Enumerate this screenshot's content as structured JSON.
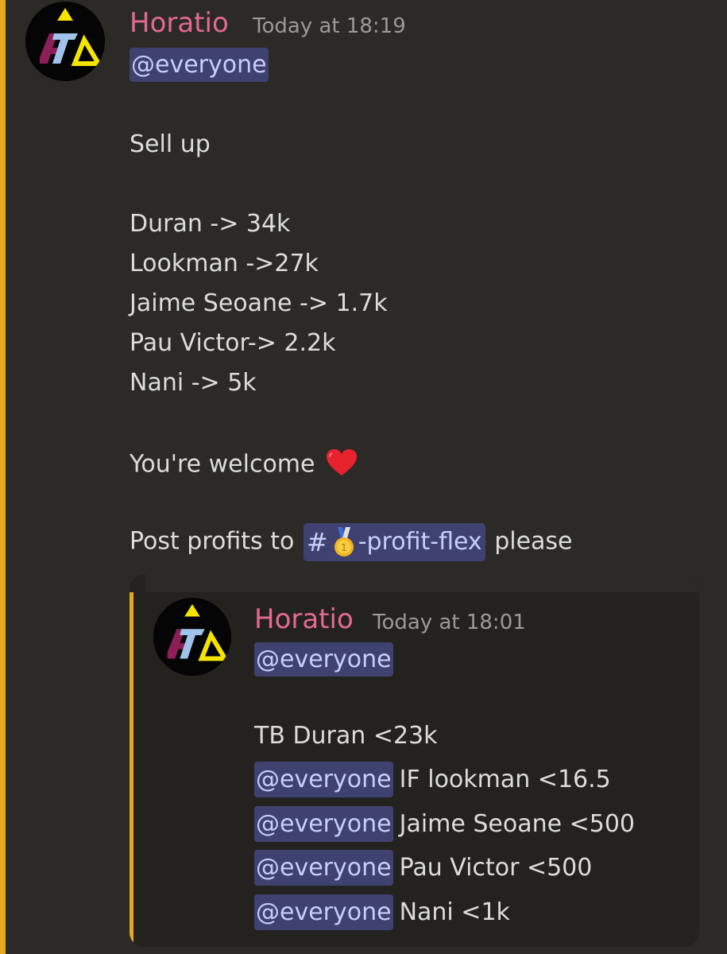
{
  "message": {
    "author": "Horatio",
    "timestamp": "Today at 18:19",
    "mention": "@everyone",
    "lines": {
      "intro": "Sell up",
      "l1": "Duran -> 34k",
      "l2": "Lookman ->27k",
      "l3": "Jaime Seoane -> 1.7k",
      "l4": "Pau Victor-> 2.2k",
      "l5": "Nani -> 5k",
      "welcome": "You're welcome",
      "post_prefix": "Post profits to",
      "channel_hash": "#",
      "channel_name": "-profit-flex",
      "post_suffix": "please"
    }
  },
  "quoted": {
    "author": "Horatio",
    "timestamp": "Today at 18:01",
    "mention": "@everyone",
    "line1": "TB Duran <23k",
    "rows": [
      {
        "mention": "@everyone",
        "text": "IF lookman <16.5"
      },
      {
        "mention": "@everyone",
        "text": "Jaime Seoane <500"
      },
      {
        "mention": "@everyone",
        "text": "Pau Victor <500"
      },
      {
        "mention": "@everyone",
        "text": "Nani <1k"
      }
    ]
  },
  "icons": {
    "avatar": "fta-logo-avatar-icon",
    "heart": "red-heart-icon",
    "medal": "gold-medal-icon"
  },
  "colors": {
    "background": "#2b2a27",
    "accent_bar": "#e7a81e",
    "author": "#e46a8e",
    "mention_bg": "#3f4170",
    "mention_text": "#c9cdfb"
  }
}
